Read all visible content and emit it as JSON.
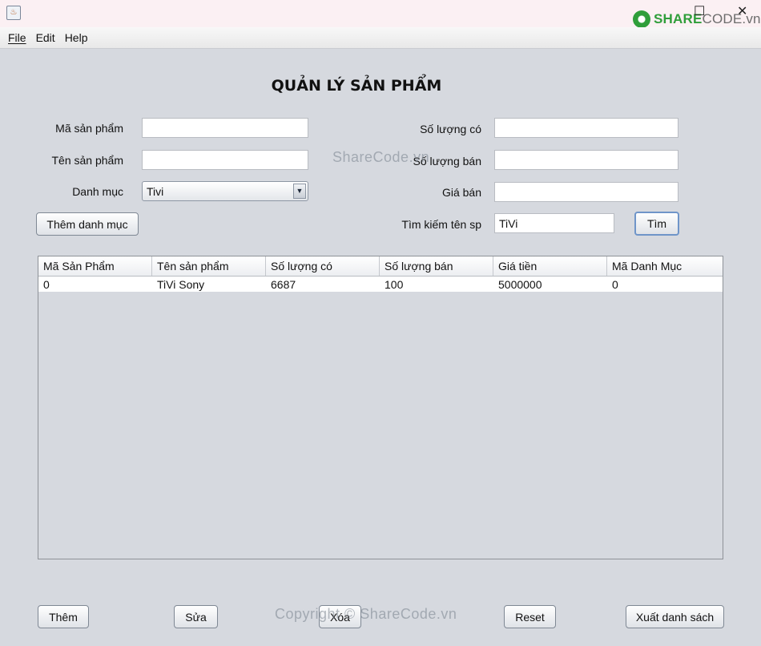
{
  "window": {
    "close_glyph": "✕",
    "maximize_glyph": "☐",
    "logo": {
      "brand": "SHARE",
      "suffix": "CODE.vn"
    }
  },
  "menu": {
    "items": [
      "File",
      "Edit",
      "Help"
    ]
  },
  "form": {
    "title": "QUẢN LÝ SẢN PHẨM",
    "labels": {
      "ma_san_pham": "Mã sản phẩm",
      "ten_san_pham": "Tên sản phẩm",
      "danh_muc": "Danh mục",
      "so_luong_co": "Số lượng có",
      "so_luong_ban": "Số lượng bán",
      "gia_ban": "Giá bán",
      "tim_kiem": "Tìm kiếm tên sp"
    },
    "values": {
      "ma_san_pham": "",
      "ten_san_pham": "",
      "danh_muc": "Tivi",
      "so_luong_co": "",
      "so_luong_ban": "",
      "gia_ban": "",
      "tim_kiem": "TiVi"
    },
    "buttons": {
      "them_danh_muc": "Thêm danh mục",
      "tim": "Tìm"
    }
  },
  "table": {
    "columns": [
      "Mã Sản Phẩm",
      "Tên sản phẩm",
      "Số lượng có",
      "Số lượng bán",
      "Giá tiền",
      "Mã Danh Mục"
    ],
    "rows": [
      [
        "0",
        "TiVi Sony",
        "6687",
        "100",
        "5000000",
        "0"
      ]
    ]
  },
  "actions": {
    "them": "Thêm",
    "sua": "Sửa",
    "xoa": "Xóa",
    "reset": "Reset",
    "xuat": "Xuất danh sách"
  },
  "watermarks": {
    "top": "ShareCode.vn",
    "bottom": "Copyright © ShareCode.vn"
  }
}
